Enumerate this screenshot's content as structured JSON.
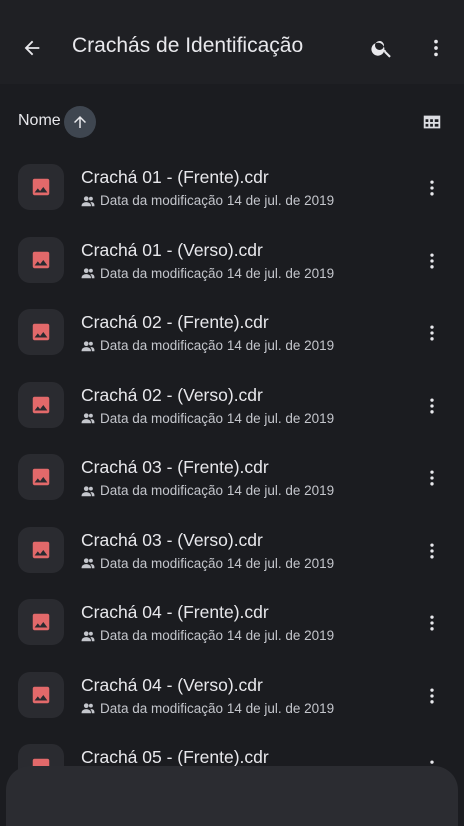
{
  "appbar": {
    "title": "Crachás de Identificação",
    "back_icon": "arrow-back-icon",
    "search_icon": "search-icon",
    "overflow_icon": "more-vert-icon"
  },
  "sort": {
    "label": "Nome",
    "direction": "ascending",
    "view_toggle_icon": "grid-view-icon"
  },
  "colors": {
    "background": "#1b1c20",
    "appbar": "#1f2024",
    "thumb_bg": "#2a2b30",
    "image_icon": "#e2696a",
    "sort_chip": "#3f4650"
  },
  "files": [
    {
      "name": "Crachá 01 - (Frente).cdr",
      "meta": "Data da modificação 14 de jul. de 2019"
    },
    {
      "name": "Crachá 01 - (Verso).cdr",
      "meta": "Data da modificação 14 de jul. de 2019"
    },
    {
      "name": "Crachá 02 - (Frente).cdr",
      "meta": "Data da modificação 14 de jul. de 2019"
    },
    {
      "name": "Crachá 02 - (Verso).cdr",
      "meta": "Data da modificação 14 de jul. de 2019"
    },
    {
      "name": "Crachá 03 - (Frente).cdr",
      "meta": "Data da modificação 14 de jul. de 2019"
    },
    {
      "name": "Crachá 03 - (Verso).cdr",
      "meta": "Data da modificação 14 de jul. de 2019"
    },
    {
      "name": "Crachá 04 - (Frente).cdr",
      "meta": "Data da modificação 14 de jul. de 2019"
    },
    {
      "name": "Crachá 04 - (Verso).cdr",
      "meta": "Data da modificação 14 de jul. de 2019"
    },
    {
      "name": "Crachá 05 - (Frente).cdr",
      "meta": ""
    }
  ]
}
